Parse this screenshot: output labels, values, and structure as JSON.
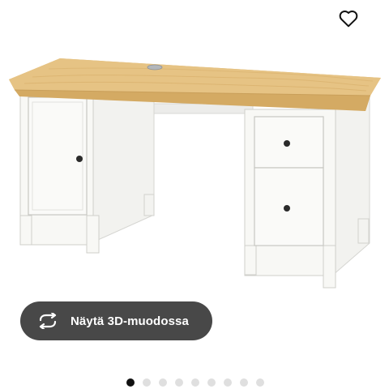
{
  "gallery": {
    "image_alt": "",
    "favourite_icon": "heart-icon",
    "view_3d": {
      "icon": "rotate-arrows-icon",
      "label": "Näytä 3D-muodossa"
    },
    "carousel": {
      "count": 9,
      "active_index": 0
    }
  },
  "colors": {
    "button_bg": "#484848",
    "button_text": "#ffffff",
    "dot_active": "#111111",
    "dot_inactive": "#dfdfdf",
    "desk_top": "#e3c07f",
    "desk_body": "#f7f7f3"
  }
}
